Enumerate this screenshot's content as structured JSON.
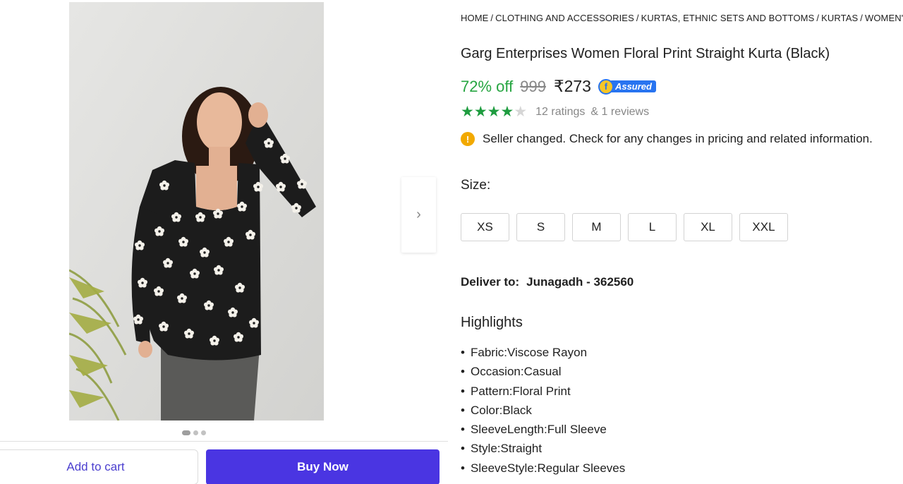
{
  "breadcrumb": [
    "HOME",
    "CLOTHING AND ACCESSORIES",
    "KURTAS, ETHNIC SETS AND BOTTOMS",
    "KURTAS",
    "WOMEN'S KURTAS"
  ],
  "product": {
    "title": "Garg Enterprises Women Floral Print Straight Kurta (Black)",
    "discount": "72% off",
    "mrp": "999",
    "price": "₹273",
    "assured_label": "Assured",
    "assured_badge_letter": "f",
    "rating_stars": 4,
    "rating_max": 5,
    "ratings_text": "12 ratings",
    "reviews_text": "& 1 reviews"
  },
  "notice": {
    "icon": "info-icon",
    "icon_glyph": "!",
    "text": "Seller changed. Check for any changes in pricing and related information."
  },
  "size": {
    "label": "Size:",
    "options": [
      "XS",
      "S",
      "M",
      "L",
      "XL",
      "XXL"
    ]
  },
  "delivery": {
    "label": "Deliver to:",
    "location": "Junagadh - 362560"
  },
  "highlights": {
    "title": "Highlights",
    "items": [
      "Fabric:Viscose Rayon",
      "Occasion:Casual",
      "Pattern:Floral Print",
      "Color:Black",
      "SleeveLength:Full Sleeve",
      "Style:Straight",
      "SleeveStyle:Regular Sleeves"
    ]
  },
  "gallery": {
    "next_arrow": "›",
    "image_count": 3,
    "active_index": 0
  },
  "actions": {
    "add_to_cart": "Add to cart",
    "buy_now": "Buy Now"
  },
  "colors": {
    "discount_green": "#26a541",
    "star_green": "#1e9c3f",
    "buy_button": "#4a35e2",
    "cart_text": "#4b3fcf",
    "assured_blue": "#2874f0",
    "info_yellow": "#f2a900"
  }
}
